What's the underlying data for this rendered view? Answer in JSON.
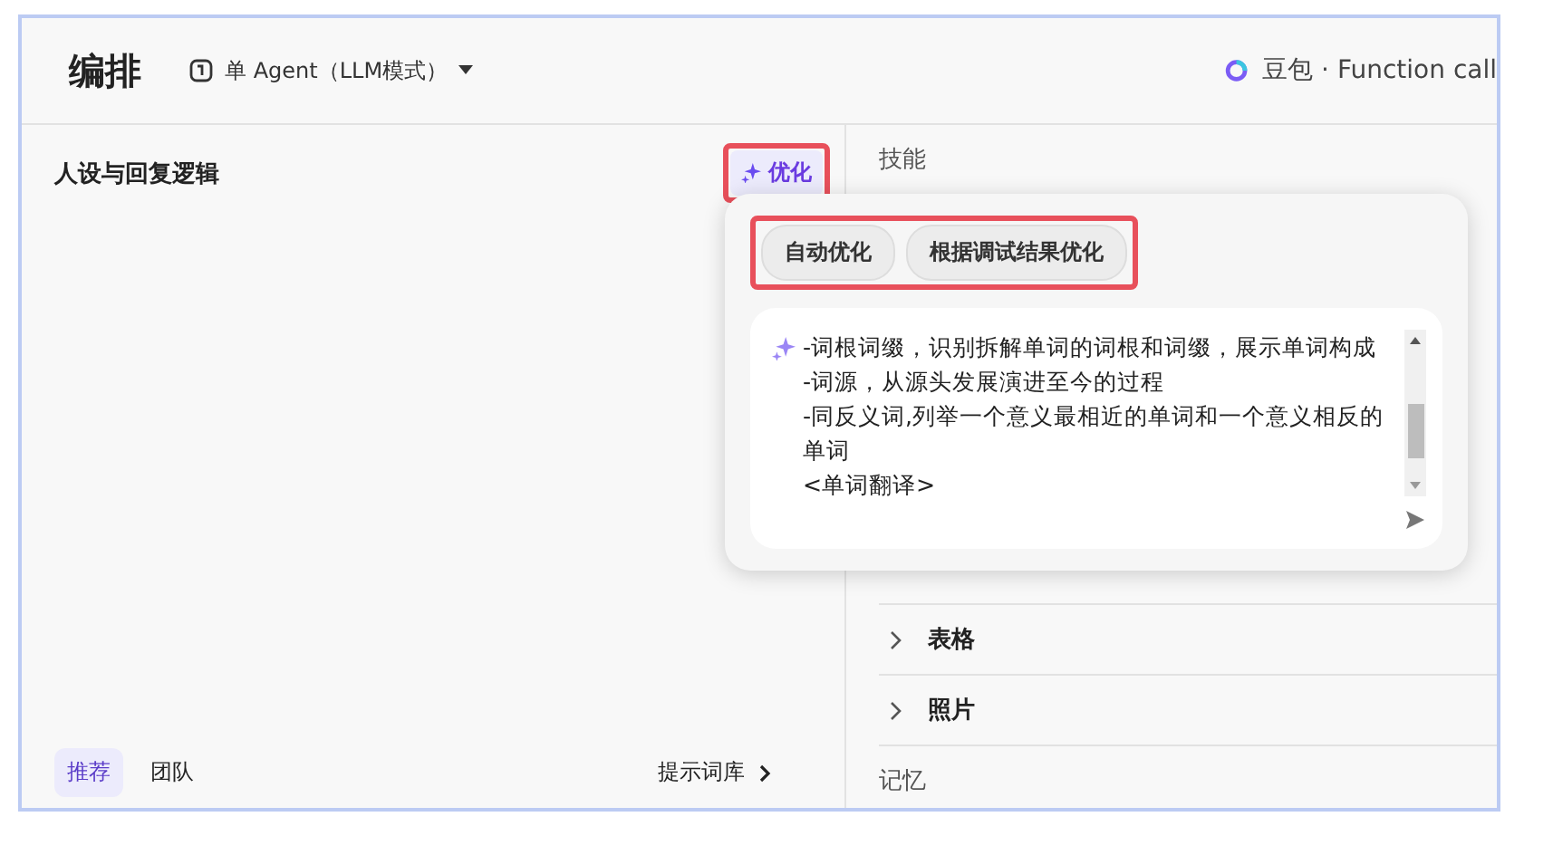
{
  "header": {
    "title": "编排",
    "agent_mode": "单 Agent（LLM模式）",
    "model": "豆包 · Function call"
  },
  "left": {
    "title": "人设与回复逻辑",
    "optimize_button": {
      "label": "优化",
      "highlighted": true
    },
    "tabs": [
      {
        "label": "推荐",
        "selected": true
      },
      {
        "label": "团队",
        "selected": false
      }
    ],
    "library_link": "提示词库"
  },
  "right": {
    "section_title": "技能",
    "items": [
      {
        "label": "表格",
        "expanded": false
      },
      {
        "label": "照片",
        "expanded": false
      }
    ],
    "memory_title": "记忆"
  },
  "popup": {
    "modes_highlighted": true,
    "modes": [
      {
        "label": "自动优化"
      },
      {
        "label": "根据调试结果优化"
      }
    ],
    "prompt_lines": [
      "-词根词缀，识别拆解单词的词根和词缀，展示单词构成",
      "-词源，从源头发展演进至今的过程",
      "-同反义词,列举一个意义最相近的单词和一个意义相反的单词",
      "<单词翻译>"
    ]
  }
}
